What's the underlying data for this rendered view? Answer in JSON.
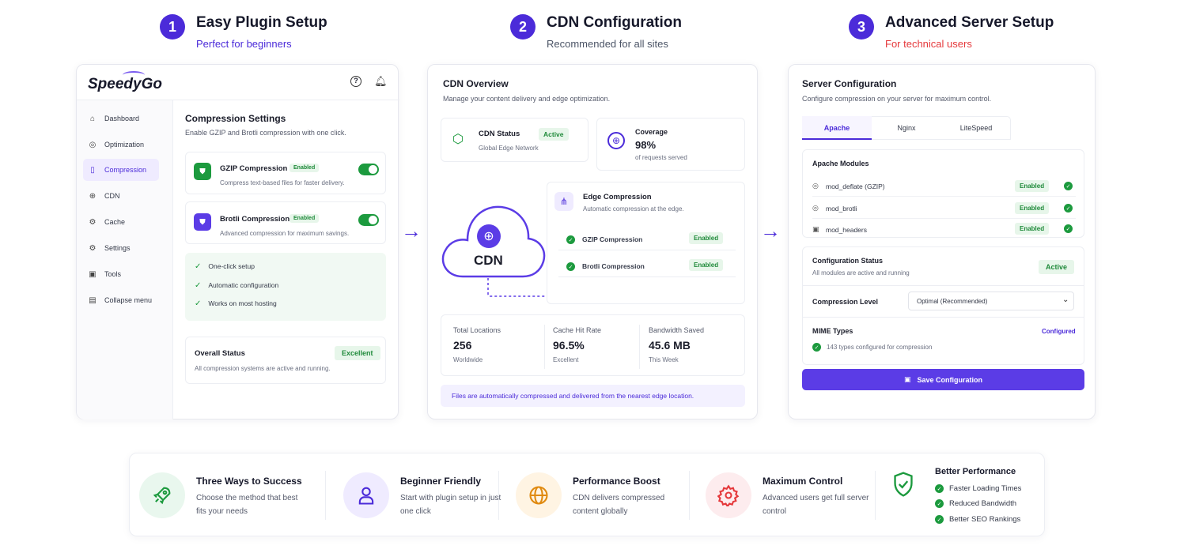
{
  "steps": [
    {
      "num": "1",
      "title": "Easy Plugin Setup",
      "subtitle": "Perfect for beginners",
      "subtitle_color": "#4b2bd9"
    },
    {
      "num": "2",
      "title": "CDN Configuration",
      "subtitle": "Recommended for all sites",
      "subtitle_color": "#4b5466"
    },
    {
      "num": "3",
      "title": "Advanced Server Setup",
      "subtitle": "For technical users",
      "subtitle_color": "#e5383b"
    }
  ],
  "plugin": {
    "logo": "SpeedyGo",
    "nav": [
      "Dashboard",
      "Optimization",
      "Compression",
      "CDN",
      "Cache",
      "Settings",
      "Tools",
      "Collapse menu"
    ],
    "title": "Compression Settings",
    "desc": "Enable GZIP and Brotli compression with one click.",
    "gzip": {
      "title": "GZIP Compression",
      "badge": "Enabled",
      "desc": "Compress text-based files for faster delivery."
    },
    "brotli": {
      "title": "Brotli Compression",
      "badge": "Enabled",
      "desc": "Advanced compression for maximum savings."
    },
    "checks": [
      "One-click setup",
      "Automatic configuration",
      "Works on most hosting"
    ],
    "status": {
      "title": "Overall Status",
      "badge": "Excellent",
      "desc": "All compression systems are active and running."
    }
  },
  "cdn": {
    "title": "CDN Overview",
    "desc": "Manage your content delivery and edge optimization.",
    "status": {
      "title": "CDN Status",
      "badge": "Active",
      "desc": "Global Edge Network"
    },
    "coverage": {
      "title": "Coverage",
      "value": "98%",
      "desc": "of requests served"
    },
    "cloud_label": "CDN",
    "edge": {
      "title": "Edge Compression",
      "desc": "Automatic compression at the edge.",
      "items": [
        {
          "label": "GZIP Compression",
          "badge": "Enabled"
        },
        {
          "label": "Brotli Compression",
          "badge": "Enabled"
        }
      ]
    },
    "stats": [
      {
        "label": "Total Locations",
        "value": "256",
        "sub": "Worldwide"
      },
      {
        "label": "Cache Hit Rate",
        "value": "96.5%",
        "sub": "Excellent"
      },
      {
        "label": "Bandwidth Saved",
        "value": "45.6 MB",
        "sub": "This Week"
      }
    ],
    "note": "Files are automatically compressed and delivered from the nearest edge location."
  },
  "server": {
    "title": "Server Configuration",
    "desc": "Configure compression on your server for maximum control.",
    "tabs": [
      "Apache",
      "Nginx",
      "LiteSpeed"
    ],
    "modules_title": "Apache Modules",
    "modules": [
      {
        "name": "mod_deflate (GZIP)",
        "badge": "Enabled"
      },
      {
        "name": "mod_brotli",
        "badge": "Enabled"
      },
      {
        "name": "mod_headers",
        "badge": "Enabled"
      }
    ],
    "config_status": {
      "title": "Configuration Status",
      "desc": "All modules are active and running",
      "badge": "Active"
    },
    "level": {
      "label": "Compression Level",
      "value": "Optimal (Recommended)"
    },
    "mime": {
      "title": "MIME Types",
      "status": "Configured",
      "desc": "143 types configured for compression"
    },
    "save": "Save Configuration"
  },
  "features": [
    {
      "title": "Three Ways to Success",
      "desc": "Choose the method that best fits your needs",
      "icon": "rocket-icon",
      "bg": "#e9f7ee",
      "color": "#1c9a3e"
    },
    {
      "title": "Beginner Friendly",
      "desc": "Start with plugin setup in just one click",
      "icon": "user-icon",
      "bg": "#efebff",
      "color": "#4b2bd9"
    },
    {
      "title": "Performance Boost",
      "desc": "CDN delivers compressed content globally",
      "icon": "globe-icon",
      "bg": "#fff4e3",
      "color": "#e08a10"
    },
    {
      "title": "Maximum Control",
      "desc": "Advanced users get full server control",
      "icon": "gear-icon",
      "bg": "#fdecee",
      "color": "#e5383b"
    }
  ],
  "performance": {
    "title": "Better Performance",
    "items": [
      "Faster Loading Times",
      "Reduced Bandwidth",
      "Better SEO Rankings"
    ]
  }
}
